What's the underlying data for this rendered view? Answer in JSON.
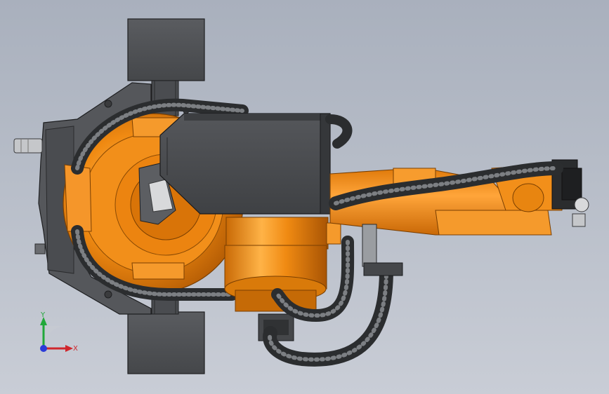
{
  "viewport": {
    "background_top": "#a9b0bd",
    "background_bottom": "#c9cdd6"
  },
  "colors": {
    "orange": "#f08a12",
    "orange_light": "#ffb347",
    "orange_dark": "#b85f05",
    "dark_gray": "#4b4d50",
    "mid_gray": "#6a6c70",
    "hose_dark": "#2f3133",
    "hose_light": "#8a8d91"
  },
  "triad": {
    "x_label": "X",
    "y_label": "Y",
    "x_color": "#d0262c",
    "y_color": "#22a83a",
    "z_color": "#2a3ad8"
  }
}
